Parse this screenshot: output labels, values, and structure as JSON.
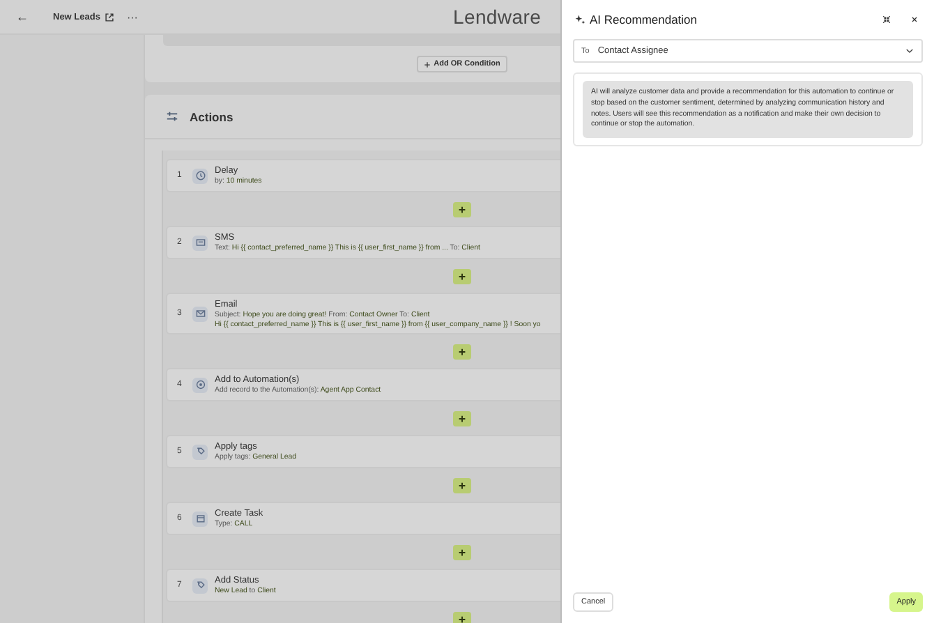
{
  "header": {
    "back": "←",
    "title": "New Leads",
    "more": "···",
    "brand": "Lendware"
  },
  "condition": {
    "add_button": "Add OR Condition"
  },
  "actions": {
    "title": "Actions",
    "steps": [
      {
        "number": "1",
        "kind": "delay",
        "title": "Delay",
        "lines": [
          "by: **10 minutes**"
        ]
      },
      {
        "number": "2",
        "kind": "sms",
        "title": "SMS",
        "lines": [
          "Text: **Hi {{ contact_preferred_name }} This is {{ user_first_name }} from ...** To: **Client**"
        ]
      },
      {
        "number": "3",
        "kind": "email",
        "title": "Email",
        "lines": [
          "Subject: **Hope you are doing great!** From: **Contact Owner** To: **Client**",
          "**Hi {{ contact_preferred_name }} This is {{ user_first_name }} from {{ user_company_name }} ! Soon yo**"
        ]
      },
      {
        "number": "4",
        "kind": "automation",
        "title": "Add to Automation(s)",
        "lines": [
          "Add record to the Automation(s): **Agent App Contact**"
        ]
      },
      {
        "number": "5",
        "kind": "tags",
        "title": "Apply tags",
        "lines": [
          "Apply tags: **General Lead**"
        ]
      },
      {
        "number": "6",
        "kind": "task",
        "title": "Create Task",
        "lines": [
          "Type: **CALL**"
        ]
      },
      {
        "number": "7",
        "kind": "status",
        "title": "Add Status",
        "lines": [
          "**New Lead** to **Client**"
        ]
      }
    ]
  },
  "drawer": {
    "title": "AI Recommendation",
    "to_label": "To",
    "to_value": "Contact Assignee",
    "description": "AI will analyze customer data and provide a recommendation for this automation to continue or stop based on the customer sentiment, determined by analyzing communication history and notes. Users will see this recommendation as a notification and make their own decision to continue or stop the automation.",
    "cancel": "Cancel",
    "apply": "Apply"
  }
}
